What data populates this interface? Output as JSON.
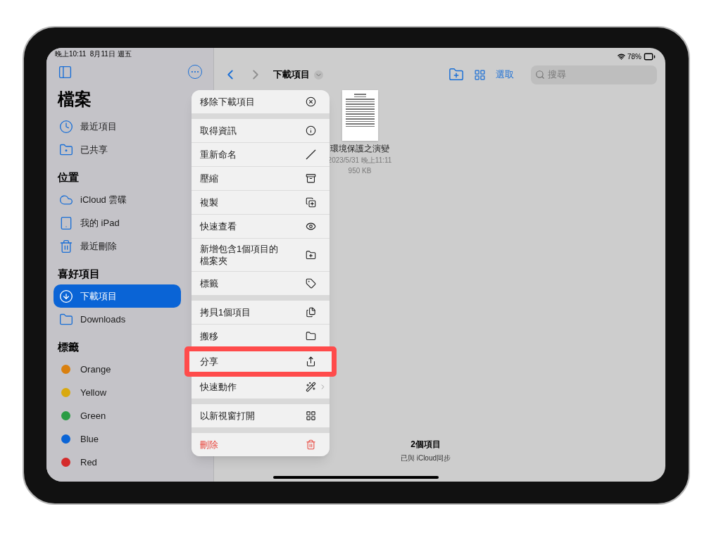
{
  "status_bar": {
    "time": "晚上10:11  8月11日 週五",
    "battery": "78%"
  },
  "sidebar": {
    "title": "檔案",
    "sections": [
      {
        "items": [
          {
            "label": "最近項目",
            "selected": false
          },
          {
            "label": "已共享",
            "selected": false
          }
        ]
      },
      {
        "heading": "位置",
        "items": [
          {
            "label": "iCloud 雲碟",
            "selected": false
          },
          {
            "label": "我的 iPad",
            "selected": false
          },
          {
            "label": "最近刪除",
            "selected": false
          }
        ]
      },
      {
        "heading": "喜好項目",
        "items": [
          {
            "label": "下載項目",
            "selected": true
          },
          {
            "label": "Downloads",
            "selected": false
          }
        ]
      },
      {
        "heading": "標籤",
        "items": [
          {
            "label": "Orange",
            "selected": false,
            "color": "#d9800f"
          },
          {
            "label": "Yellow",
            "selected": false,
            "color": "#d9a90f"
          },
          {
            "label": "Green",
            "selected": false,
            "color": "#2a9c44"
          },
          {
            "label": "Blue",
            "selected": false,
            "color": "#0a64d6"
          },
          {
            "label": "Red",
            "selected": false,
            "color": "#d42b2b"
          }
        ]
      }
    ]
  },
  "toolbar": {
    "title": "下載項目",
    "select": "選取",
    "search": {
      "placeholder": "搜尋"
    }
  },
  "file": {
    "name": "環境保護之演變",
    "date": "2023/5/31 晚上11:11",
    "size": "950 KB"
  },
  "menu": {
    "groups": [
      [
        {
          "label": "移除下載項目",
          "kind": "plain",
          "highlighted": false
        }
      ],
      [
        {
          "label": "取得資訊",
          "kind": "plain",
          "highlighted": false
        },
        {
          "label": "重新命名",
          "kind": "plain",
          "highlighted": false
        },
        {
          "label": "壓縮",
          "kind": "plain",
          "highlighted": false
        },
        {
          "label": "複製",
          "kind": "plain",
          "highlighted": false
        },
        {
          "label": "快速查看",
          "kind": "plain",
          "highlighted": false
        },
        {
          "label": "新增包含1個項目的檔案夾",
          "kind": "plain",
          "highlighted": false
        },
        {
          "label": "標籤",
          "kind": "plain",
          "highlighted": false
        }
      ],
      [
        {
          "label": "拷貝1個項目",
          "kind": "plain",
          "highlighted": false
        },
        {
          "label": "搬移",
          "kind": "plain",
          "highlighted": false
        },
        {
          "label": "分享",
          "kind": "plain",
          "highlighted": true
        },
        {
          "label": "快速動作",
          "kind": "submenu",
          "highlighted": false
        }
      ],
      [
        {
          "label": "以新視窗打開",
          "kind": "plain",
          "highlighted": false
        }
      ],
      [
        {
          "label": "刪除",
          "kind": "destructive",
          "highlighted": false
        }
      ]
    ]
  },
  "footer": {
    "count": "2個項目",
    "sync": "已與 iCloud同步"
  }
}
